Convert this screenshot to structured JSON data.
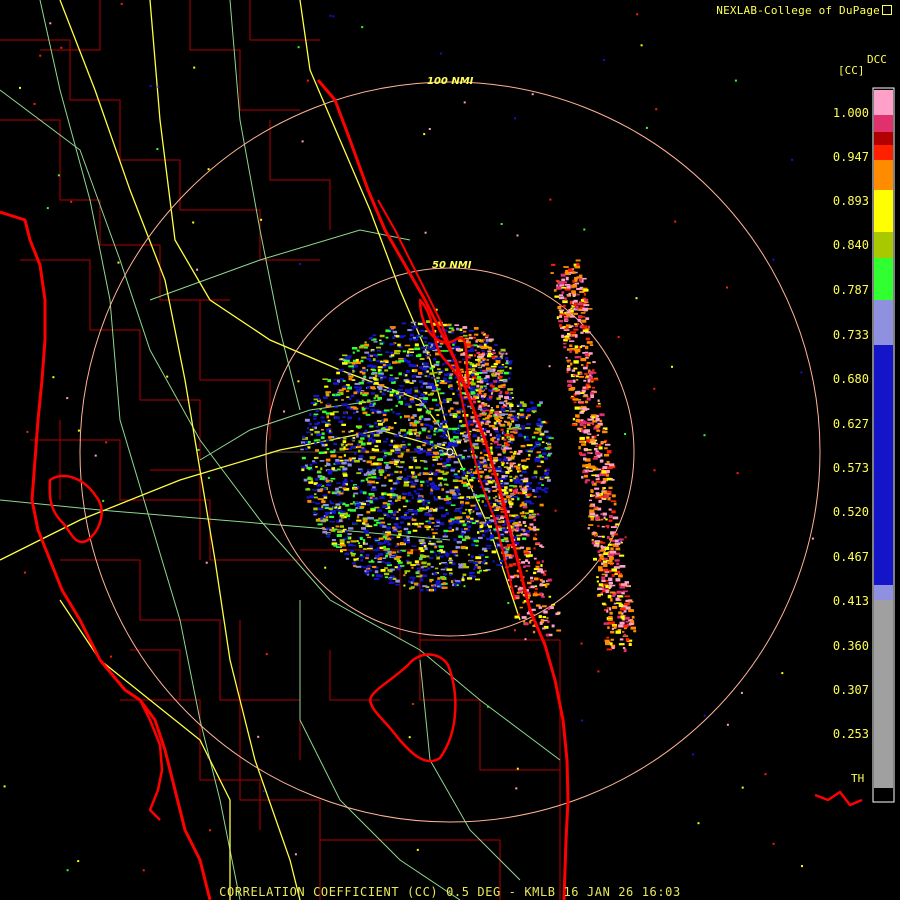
{
  "header": {
    "credit": "NEXLAB-College of DuPage"
  },
  "product": {
    "code": "DCC",
    "unit": "[CC]",
    "title": "CORRELATION COEFFICIENT (CC) 0.5 DEG - KMLB 16 JAN 26 16:03"
  },
  "map": {
    "ring_labels": [
      "100 NMI",
      "50 NMI"
    ],
    "threshold_label": "TH"
  },
  "legend": {
    "labels": [
      "1.000",
      "0.947",
      "0.893",
      "0.840",
      "0.787",
      "0.733",
      "0.680",
      "0.627",
      "0.573",
      "0.520",
      "0.467",
      "0.413",
      "0.360",
      "0.307",
      "0.253"
    ],
    "colors": {
      "pink": "#ffa0c8",
      "magenta": "#e0306e",
      "dark_red": "#b00000",
      "red": "#ff2000",
      "orange": "#ff8c00",
      "yellow": "#ffff00",
      "yellow_green": "#a8c800",
      "green": "#30ff30",
      "lavender": "#9090e0",
      "blue": "#1414c8",
      "gray": "#a0a0a0",
      "coastline": "#ff0000",
      "highway": "#ffff40",
      "county": "#c80000",
      "road": "#90e090",
      "ring": "#ffb496"
    }
  }
}
